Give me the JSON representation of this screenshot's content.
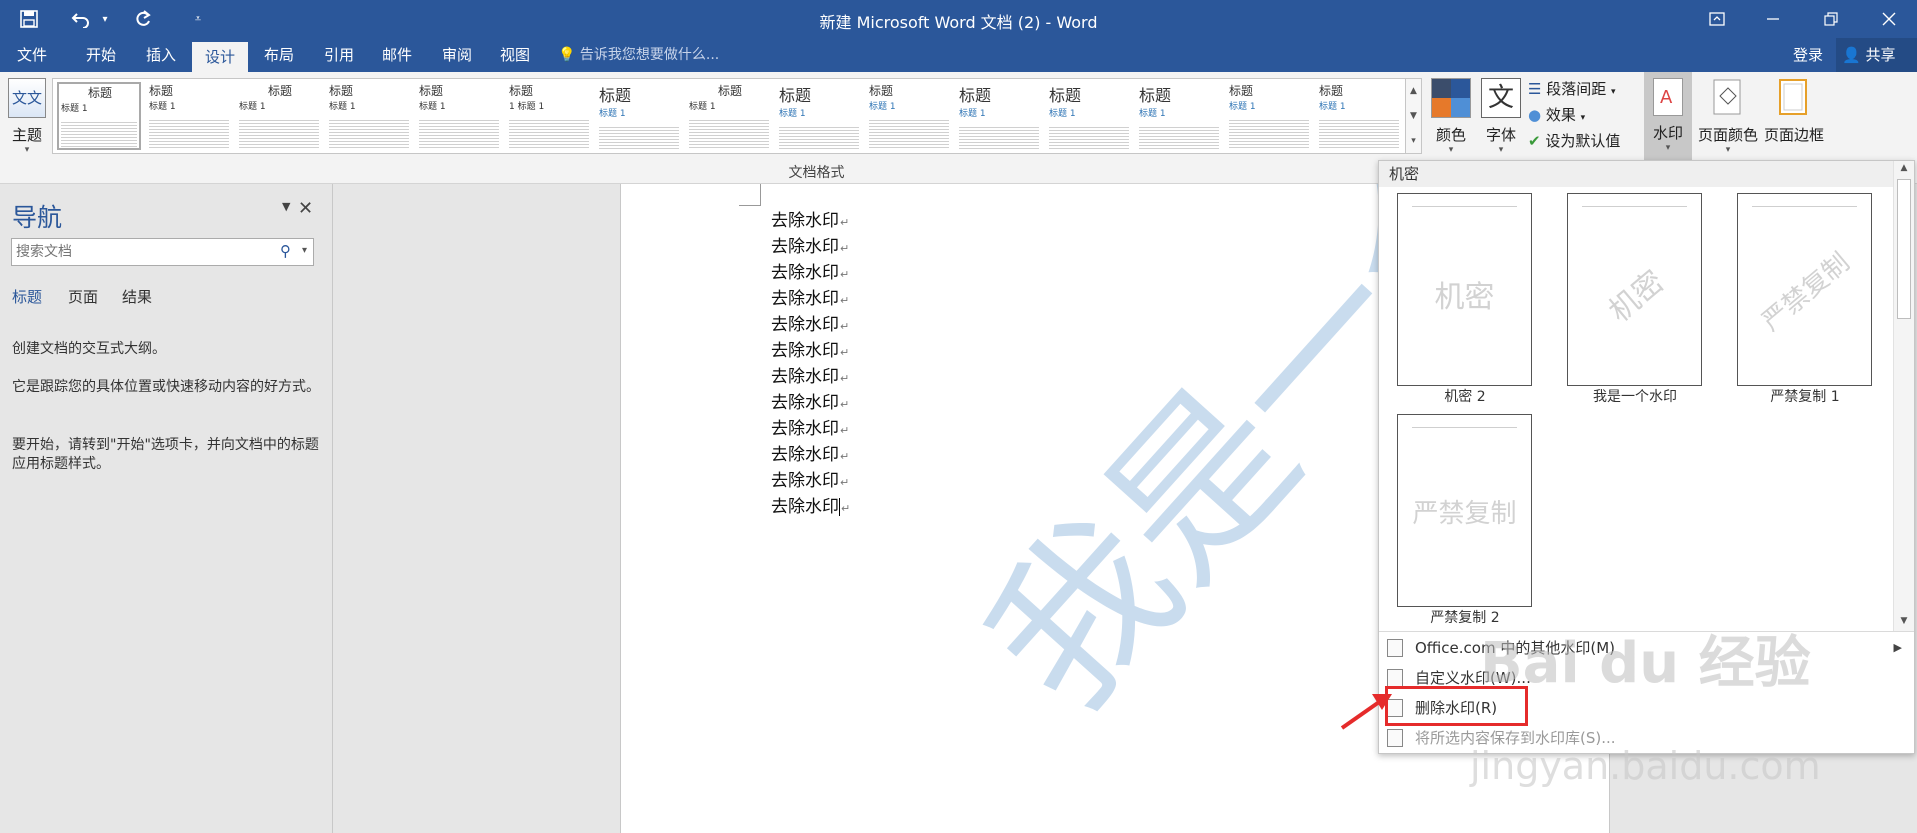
{
  "window": {
    "title": "新建 Microsoft Word 文档 (2) - Word",
    "quick_access": {
      "save_icon": "save-icon",
      "undo_icon": "undo-icon",
      "undo_drop_icon": "chevron-down-icon",
      "redo_icon": "redo-icon",
      "customize_icon": "customize-qat-icon"
    },
    "controls": {
      "ribbon_display_icon": "ribbon-display-icon",
      "minimize_icon": "minimize-icon",
      "restore_icon": "restore-icon",
      "close_icon": "close-icon"
    }
  },
  "tabs": [
    "文件",
    "开始",
    "插入",
    "设计",
    "布局",
    "引用",
    "邮件",
    "审阅",
    "视图"
  ],
  "active_tab": "设计",
  "tell_me": "告诉我您想要做什么...",
  "account": {
    "login": "登录",
    "share": "共享"
  },
  "ribbon": {
    "theme": {
      "icon_text": "文文",
      "label": "主题"
    },
    "gallery": [
      {
        "title": "标题",
        "sub": "标题 1",
        "style": "center"
      },
      {
        "title": "标题",
        "sub": "标题 1",
        "style": "plain"
      },
      {
        "title": "标题",
        "sub": "标题 1",
        "style": "center"
      },
      {
        "title": "标题",
        "sub": "标题 1",
        "style": "plain"
      },
      {
        "title": "标题",
        "sub": "标题 1",
        "style": "plain"
      },
      {
        "title": "标题",
        "sub": "1 标题 1",
        "style": "plain"
      },
      {
        "title": "标题",
        "sub": "标题 1",
        "style": "big"
      },
      {
        "title": "标题",
        "sub": "标题 1",
        "style": "center"
      },
      {
        "title": "标题",
        "sub": "标题 1",
        "style": "big"
      },
      {
        "title": "标题",
        "sub": "标题 1",
        "style": "blue"
      },
      {
        "title": "标题",
        "sub": "标题 1",
        "style": "big"
      },
      {
        "title": "标题",
        "sub": "标题 1",
        "style": "big"
      },
      {
        "title": "标题",
        "sub": "标题 1",
        "style": "big"
      },
      {
        "title": "标题",
        "sub": "标题 1",
        "style": "blue"
      },
      {
        "title": "标题",
        "sub": "标题 1",
        "style": "blue"
      }
    ],
    "colors": {
      "label": "颜色",
      "swatches": [
        "#3b4d6b",
        "#2b579a",
        "#e6792a",
        "#4f8fd6"
      ]
    },
    "fonts": {
      "label": "字体",
      "icon_text": "文"
    },
    "para_spacing": "段落间距",
    "effects": "效果",
    "set_default": "设为默认值",
    "watermark": "水印",
    "page_color": "页面颜色",
    "page_border": "页面边框",
    "group_label": "文档格式"
  },
  "nav_pane": {
    "title": "导航",
    "search_placeholder": "搜索文档",
    "tabs": [
      "标题",
      "页面",
      "结果"
    ],
    "active_tab": "标题",
    "p1": "创建文档的交互式大纲。",
    "p2": "它是跟踪您的具体位置或快速移动内容的好方式。",
    "p3": "要开始，请转到\"开始\"选项卡，并向文档中的标题应用标题样式。"
  },
  "document": {
    "lines": [
      "去除水印",
      "去除水印",
      "去除水印",
      "去除水印",
      "去除水印",
      "去除水印",
      "去除水印",
      "去除水印",
      "去除水印",
      "去除水印",
      "去除水印",
      "去除水印"
    ],
    "paragraph_mark": "↵",
    "watermark_text": "我是一个水印"
  },
  "watermark_menu": {
    "section": "机密",
    "thumbnails": [
      {
        "text": "机密",
        "caption": "机密 2",
        "rotated": false
      },
      {
        "text": "机密",
        "caption": "我是一个水印",
        "rotated": true
      },
      {
        "text": "严禁复制",
        "caption": "严禁复制 1",
        "rotated": true
      },
      {
        "text": "严禁复制",
        "caption": "严禁复制 2",
        "rotated": false
      }
    ],
    "items": [
      {
        "label": "Office.com 中的其他水印(M)",
        "disabled": false,
        "submenu": true
      },
      {
        "label": "自定义水印(W)...",
        "disabled": false,
        "submenu": false
      },
      {
        "label": "删除水印(R)",
        "disabled": false,
        "submenu": false
      },
      {
        "label": "将所选内容保存到水印库(S)...",
        "disabled": true,
        "submenu": false
      }
    ]
  },
  "overlay": {
    "brand": "Bai du 经验",
    "url": "jingyan.baidu.com"
  },
  "colors": {
    "title_bar": "#2b579a",
    "highlight": "#e52b2b",
    "watermark": "#c9dcee"
  }
}
